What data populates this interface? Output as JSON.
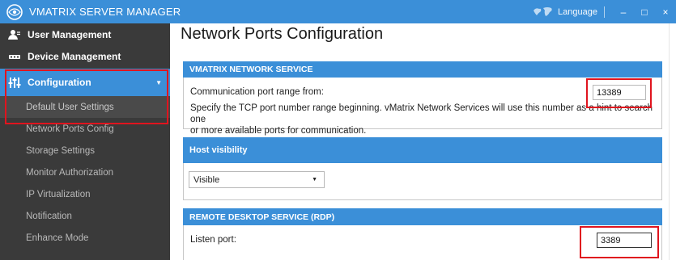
{
  "titlebar": {
    "app_title": "VMATRIX SERVER MANAGER",
    "language_label": "Language",
    "minimize": "–",
    "maximize": "□",
    "close": "×"
  },
  "sidebar": {
    "user_management": "User Management",
    "device_management": "Device Management",
    "configuration": "Configuration",
    "items": [
      "Default User Settings",
      "Network Ports Config",
      "Storage Settings",
      "Monitor Authorization",
      "IP Virtualization",
      "Notification",
      "Enhance Mode"
    ]
  },
  "main": {
    "page_title": "Network Ports Configuration",
    "network_service": {
      "header": "VMATRIX NETWORK SERVICE",
      "label": "Communication port range from:",
      "value": "13389",
      "description_line1": "Specify the TCP port number range beginning. vMatrix Network Services will use this number as a hint to search one",
      "description_line2": "or more available ports for communication."
    },
    "host_visibility": {
      "header": "Host visibility",
      "selected": "Visible"
    },
    "rdp": {
      "header": "REMOTE DESKTOP SERVICE (RDP)",
      "label": "Listen port:",
      "value": "3389"
    }
  },
  "colors": {
    "accent": "#3b8fd8",
    "sidebar_bg": "#3a3a3a",
    "highlight_red": "#e0141e"
  }
}
